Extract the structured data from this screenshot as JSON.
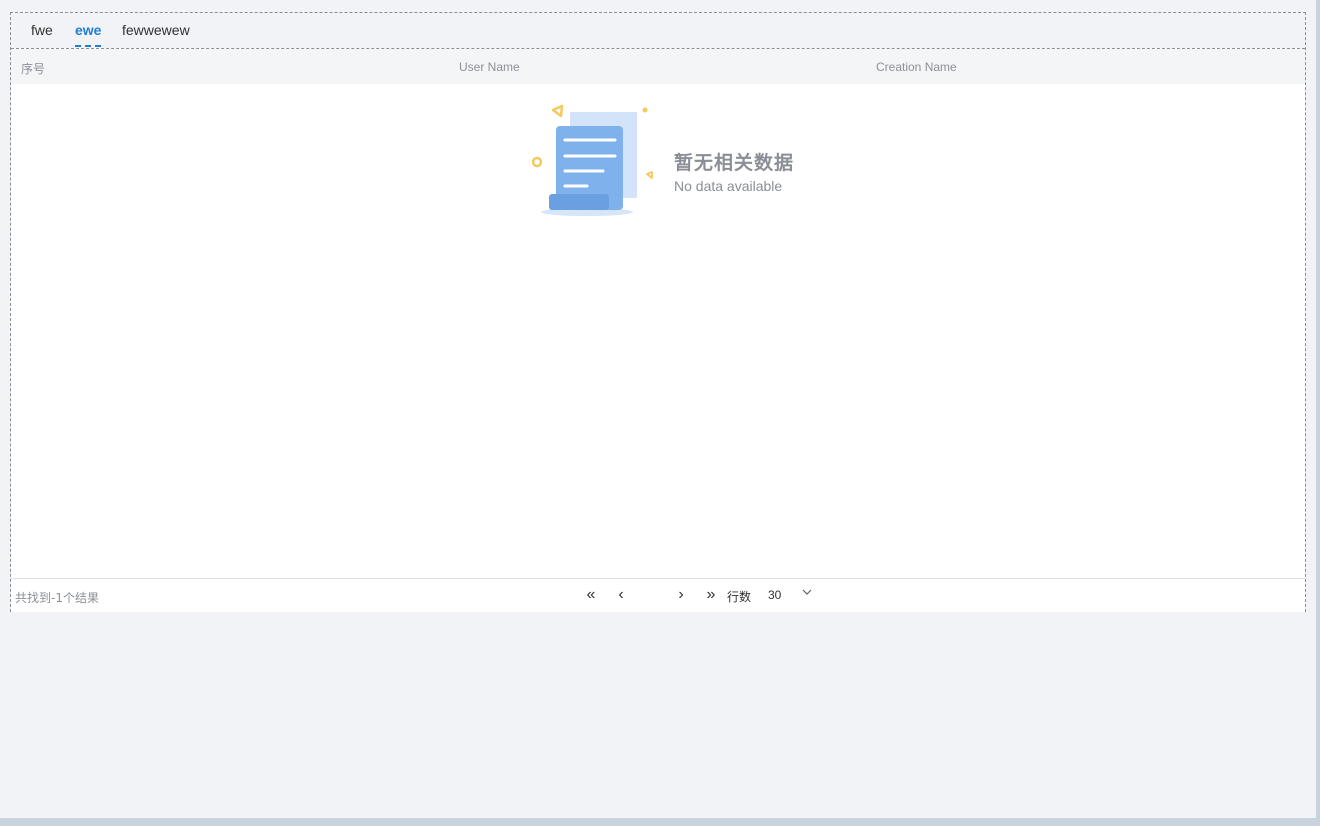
{
  "tabs": [
    {
      "label": "fwe",
      "active": false
    },
    {
      "label": "ewe",
      "active": true
    },
    {
      "label": "fewwewew",
      "active": false
    }
  ],
  "table": {
    "columns": [
      "序号",
      "User Name",
      "Creation Name"
    ],
    "rows": []
  },
  "empty_state": {
    "title": "暂无相关数据",
    "subtitle": "No data available",
    "icon": "empty-document-icon"
  },
  "footer": {
    "total_text": "共找到-1个结果",
    "first_page": "«",
    "prev_page": "‹",
    "next_page": "›",
    "last_page": "»",
    "rows_label": "行数",
    "rows_per_page": "30"
  },
  "colors": {
    "accent": "#1f7fd6",
    "background": "#f1f3f6",
    "header_bg": "#f4f5f7",
    "illustration_blue": "#7fb1ec",
    "illustration_yellow": "#f5c95a"
  }
}
